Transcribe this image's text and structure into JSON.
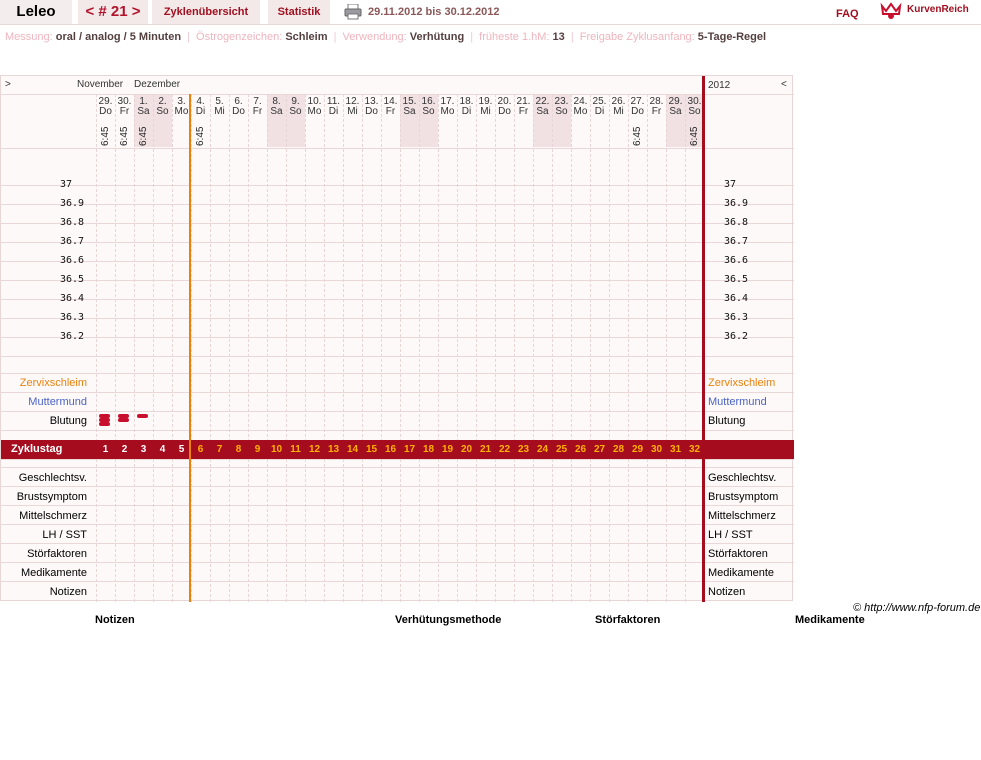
{
  "header": {
    "app_title": "Leleo",
    "cycle_nav": "< # 21 >",
    "tab_overview": "Zyklenübersicht",
    "tab_stats": "Statistik",
    "date_range": "29.11.2012 bis 30.12.2012",
    "faq": "FAQ",
    "brand": "KurvenReich",
    "print_icon": "printer-icon",
    "logo_icon": "crown-heart-icon"
  },
  "info": {
    "measure_label": "Messung:",
    "measure_value": "oral / analog / 5 Minuten",
    "estrogen_label": "Östrogenzeichen:",
    "estrogen_value": "Schleim",
    "use_label": "Verwendung:",
    "use_value": "Verhütung",
    "hm_label": "früheste 1.hM:",
    "hm_value": "13",
    "release_label": "Freigabe Zyklusanfang:",
    "release_value": "5-Tage-Regel"
  },
  "chart_nav": {
    "prev": ">",
    "next": "<",
    "month1": "November",
    "month2": "Dezember",
    "year": "2012"
  },
  "days": [
    {
      "d": "29.",
      "w": "Do",
      "t": "6:45",
      "we": false
    },
    {
      "d": "30.",
      "w": "Fr",
      "t": "6:45",
      "we": false
    },
    {
      "d": "1.",
      "w": "Sa",
      "t": "6:45",
      "we": true
    },
    {
      "d": "2.",
      "w": "So",
      "t": "",
      "we": true
    },
    {
      "d": "3.",
      "w": "Mo",
      "t": "",
      "we": false
    },
    {
      "d": "4.",
      "w": "Di",
      "t": "6:45",
      "we": false
    },
    {
      "d": "5.",
      "w": "Mi",
      "t": "",
      "we": false
    },
    {
      "d": "6.",
      "w": "Do",
      "t": "",
      "we": false
    },
    {
      "d": "7.",
      "w": "Fr",
      "t": "",
      "we": false
    },
    {
      "d": "8.",
      "w": "Sa",
      "t": "",
      "we": true
    },
    {
      "d": "9.",
      "w": "So",
      "t": "",
      "we": true
    },
    {
      "d": "10.",
      "w": "Mo",
      "t": "",
      "we": false
    },
    {
      "d": "11.",
      "w": "Di",
      "t": "",
      "we": false
    },
    {
      "d": "12.",
      "w": "Mi",
      "t": "",
      "we": false
    },
    {
      "d": "13.",
      "w": "Do",
      "t": "",
      "we": false
    },
    {
      "d": "14.",
      "w": "Fr",
      "t": "",
      "we": false
    },
    {
      "d": "15.",
      "w": "Sa",
      "t": "",
      "we": true
    },
    {
      "d": "16.",
      "w": "So",
      "t": "",
      "we": true
    },
    {
      "d": "17.",
      "w": "Mo",
      "t": "",
      "we": false
    },
    {
      "d": "18.",
      "w": "Di",
      "t": "",
      "we": false
    },
    {
      "d": "19.",
      "w": "Mi",
      "t": "",
      "we": false
    },
    {
      "d": "20.",
      "w": "Do",
      "t": "",
      "we": false
    },
    {
      "d": "21.",
      "w": "Fr",
      "t": "",
      "we": false
    },
    {
      "d": "22.",
      "w": "Sa",
      "t": "",
      "we": true
    },
    {
      "d": "23.",
      "w": "So",
      "t": "",
      "we": true
    },
    {
      "d": "24.",
      "w": "Mo",
      "t": "",
      "we": false
    },
    {
      "d": "25.",
      "w": "Di",
      "t": "",
      "we": false
    },
    {
      "d": "26.",
      "w": "Mi",
      "t": "",
      "we": false
    },
    {
      "d": "27.",
      "w": "Do",
      "t": "6:45",
      "we": false
    },
    {
      "d": "28.",
      "w": "Fr",
      "t": "",
      "we": false
    },
    {
      "d": "29.",
      "w": "Sa",
      "t": "",
      "we": true
    },
    {
      "d": "30.",
      "w": "So",
      "t": "6:45",
      "we": true
    }
  ],
  "temperatures": [
    "37",
    "36.9",
    "36.8",
    "36.7",
    "36.6",
    "36.5",
    "36.4",
    "36.3",
    "36.2"
  ],
  "bleeding": [
    3,
    2,
    1
  ],
  "rows": {
    "zervix": "Zervixschleim",
    "muttermund": "Muttermund",
    "blutung": "Blutung",
    "zyklustag": "Zyklustag",
    "bottom": [
      "Geschlechtsv.",
      "Brustsymptom",
      "Mittelschmerz",
      "LH / SST",
      "Störfaktoren",
      "Medikamente",
      "Notizen"
    ]
  },
  "cycle_days": [
    "1",
    "2",
    "3",
    "4",
    "5",
    "6",
    "7",
    "8",
    "9",
    "10",
    "11",
    "12",
    "13",
    "14",
    "15",
    "16",
    "17",
    "18",
    "19",
    "20",
    "21",
    "22",
    "23",
    "24",
    "25",
    "26",
    "27",
    "28",
    "29",
    "30",
    "31",
    "32"
  ],
  "cycle_days_white_until": 5,
  "footer": {
    "copyright": "© http://www.nfp-forum.de",
    "notes": "Notizen",
    "method": "Verhütungsmethode",
    "disturb": "Störfaktoren",
    "meds": "Medikamente"
  },
  "colors": {
    "accent": "#a50d1f",
    "zervix": "#e8820c",
    "muttermund": "#4a63c4",
    "cycle_orange": "#ffb000",
    "weekend": "#f1e1e3",
    "bleeding": "#c8102e"
  }
}
